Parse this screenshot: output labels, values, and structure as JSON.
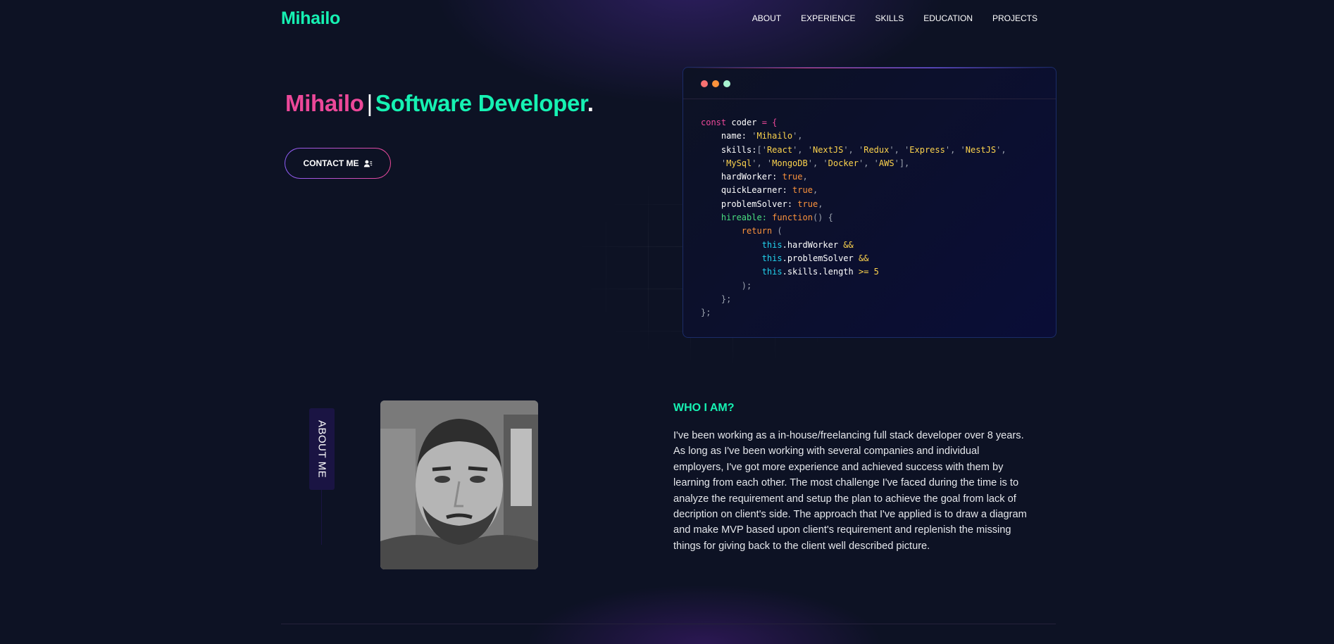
{
  "nav": {
    "logo": "Mihailo",
    "links": [
      "ABOUT",
      "EXPERIENCE",
      "SKILLS",
      "EDUCATION",
      "PROJECTS"
    ]
  },
  "hero": {
    "name": "Mihailo",
    "separator": "|",
    "role": "Software Developer",
    "dot": ".",
    "contact_label": "CONTACT ME",
    "contact_icon": "user-contact-icon"
  },
  "code_window": {
    "dot_colors": [
      "#f87171",
      "#fb923c",
      "#a7f3d0"
    ],
    "lines": [
      [
        {
          "t": "const ",
          "c": "k-pink"
        },
        {
          "t": "coder",
          "c": "k-white"
        },
        {
          "t": " = {",
          "c": "k-pink"
        }
      ],
      [
        {
          "t": "    name: ",
          "c": "k-white"
        },
        {
          "t": "'",
          "c": "k-gray"
        },
        {
          "t": "Mihailo",
          "c": "k-amber"
        },
        {
          "t": "',",
          "c": "k-gray"
        }
      ],
      [
        {
          "t": "    skills:",
          "c": "k-white"
        },
        {
          "t": "['",
          "c": "k-gray"
        },
        {
          "t": "React",
          "c": "k-amber"
        },
        {
          "t": "', '",
          "c": "k-gray"
        },
        {
          "t": "NextJS",
          "c": "k-amber"
        },
        {
          "t": "', '",
          "c": "k-gray"
        },
        {
          "t": "Redux",
          "c": "k-amber"
        },
        {
          "t": "', '",
          "c": "k-gray"
        },
        {
          "t": "Express",
          "c": "k-amber"
        },
        {
          "t": "', '",
          "c": "k-gray"
        },
        {
          "t": "NestJS",
          "c": "k-amber"
        },
        {
          "t": "',",
          "c": "k-gray"
        }
      ],
      [
        {
          "t": "    '",
          "c": "k-gray"
        },
        {
          "t": "MySql",
          "c": "k-amber"
        },
        {
          "t": "', '",
          "c": "k-gray"
        },
        {
          "t": "MongoDB",
          "c": "k-amber"
        },
        {
          "t": "', '",
          "c": "k-gray"
        },
        {
          "t": "Docker",
          "c": "k-amber"
        },
        {
          "t": "', '",
          "c": "k-gray"
        },
        {
          "t": "AWS",
          "c": "k-amber"
        },
        {
          "t": "'],",
          "c": "k-gray"
        }
      ],
      [
        {
          "t": "    hardWorker: ",
          "c": "k-white"
        },
        {
          "t": "true",
          "c": "k-orange"
        },
        {
          "t": ",",
          "c": "k-gray"
        }
      ],
      [
        {
          "t": "    quickLearner: ",
          "c": "k-white"
        },
        {
          "t": "true",
          "c": "k-orange"
        },
        {
          "t": ",",
          "c": "k-gray"
        }
      ],
      [
        {
          "t": "    problemSolver: ",
          "c": "k-white"
        },
        {
          "t": "true",
          "c": "k-orange"
        },
        {
          "t": ",",
          "c": "k-gray"
        }
      ],
      [
        {
          "t": "    hireable: ",
          "c": "k-green"
        },
        {
          "t": "function",
          "c": "k-orange"
        },
        {
          "t": "() {",
          "c": "k-gray"
        }
      ],
      [
        {
          "t": "        return ",
          "c": "k-orange"
        },
        {
          "t": "(",
          "c": "k-gray"
        }
      ],
      [
        {
          "t": "            this",
          "c": "k-cyan"
        },
        {
          "t": ".hardWorker ",
          "c": "k-white"
        },
        {
          "t": "&&",
          "c": "k-amber"
        }
      ],
      [
        {
          "t": "            this",
          "c": "k-cyan"
        },
        {
          "t": ".problemSolver ",
          "c": "k-white"
        },
        {
          "t": "&&",
          "c": "k-amber"
        }
      ],
      [
        {
          "t": "            this",
          "c": "k-cyan"
        },
        {
          "t": ".skills.length ",
          "c": "k-white"
        },
        {
          "t": ">= 5",
          "c": "k-amber"
        }
      ],
      [
        {
          "t": "        );",
          "c": "k-gray"
        }
      ],
      [
        {
          "t": "    };",
          "c": "k-gray"
        }
      ],
      [
        {
          "t": "};",
          "c": "k-gray"
        }
      ]
    ]
  },
  "about": {
    "tab_label": "ABOUT ME",
    "photo_label": "profile-photo",
    "title": "WHO I AM?",
    "text": "I've been working as a in-house/freelancing full stack developer over 8 years. As long as I've been working with several companies and individual employers, I've got more experience and achieved success with them by learning from each other. The most challenge I've faced during the time is to analyze the requirement and setup the plan to achieve the goal from lack of decription on client's side. The approach that I've applied is to draw a diagram and make MVP based upon client's requirement and replenish the missing things for giving back to the client well described picture."
  }
}
